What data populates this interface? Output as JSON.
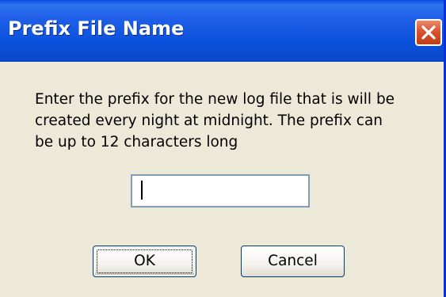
{
  "window": {
    "title": "Prefix File Name"
  },
  "dialog": {
    "message_lines": [
      "Enter the prefix for the new log file that is will be",
      "created every night at midnight.  The prefix can",
      "be up to 12 characters long"
    ],
    "prefix_input": {
      "value": "",
      "placeholder": ""
    },
    "ok_label": "OK",
    "cancel_label": "Cancel"
  },
  "icons": {
    "close": "close-icon"
  },
  "colors": {
    "titlebar": "#0a50dc",
    "close_button": "#d9532f",
    "dialog_background": "#ece9d8",
    "input_border": "#7f9db9",
    "button_border": "#003c74"
  }
}
